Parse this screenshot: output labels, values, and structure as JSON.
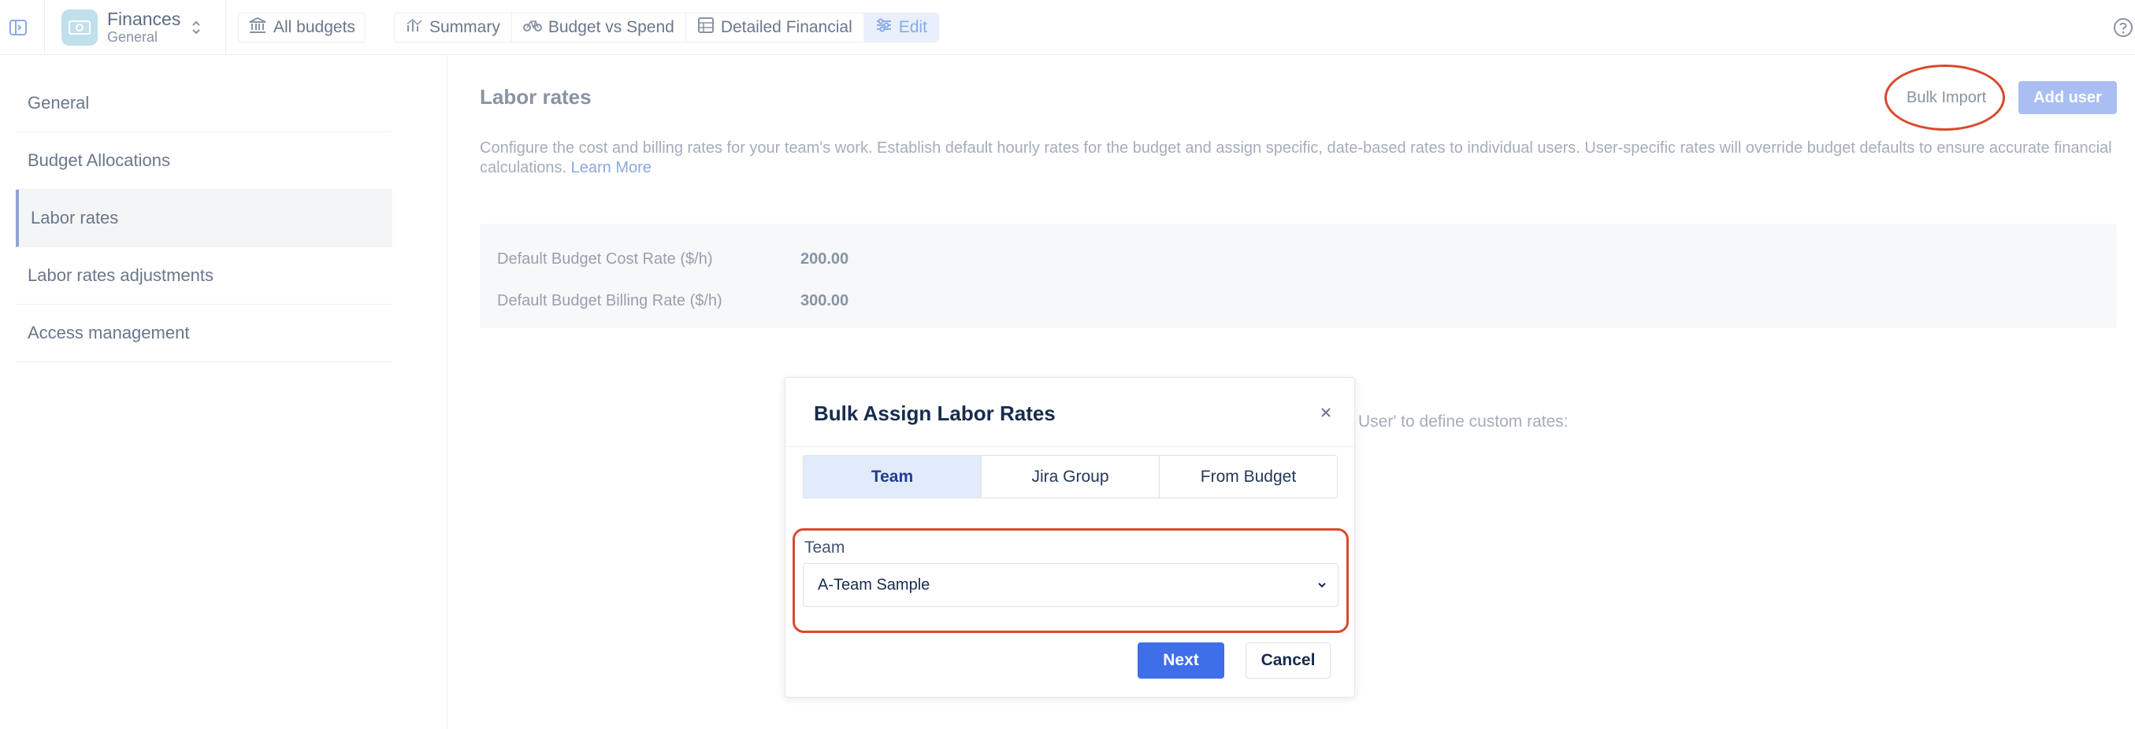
{
  "topbar": {
    "app_title": "Finances",
    "app_subtitle": "General",
    "all_budgets": "All budgets",
    "tabs": [
      {
        "label": "Summary",
        "icon": "chart-icon"
      },
      {
        "label": "Budget vs Spend",
        "icon": "bicycle-icon"
      },
      {
        "label": "Detailed Financial",
        "icon": "table-icon"
      },
      {
        "label": "Edit",
        "icon": "sliders-icon",
        "active": true
      }
    ]
  },
  "sidebar": {
    "items": [
      {
        "label": "General"
      },
      {
        "label": "Budget Allocations"
      },
      {
        "label": "Labor rates",
        "active": true
      },
      {
        "label": "Labor rates adjustments"
      },
      {
        "label": "Access management"
      }
    ]
  },
  "main": {
    "title": "Labor rates",
    "description": "Configure the cost and billing rates for your team's work. Establish default hourly rates for the budget and assign specific, date-based rates to individual users. User-specific rates will override budget defaults to ensure accurate financial calculations.",
    "learn_more": "Learn More",
    "bulk_import": "Bulk Import",
    "add_user": "Add user",
    "default_cost_label": "Default Budget Cost Rate ($/h)",
    "default_cost_value": "200.00",
    "default_billing_label": "Default Budget Billing Rate ($/h)",
    "default_billing_value": "300.00",
    "hint": "User' to define custom rates:"
  },
  "modal": {
    "title": "Bulk Assign Labor Rates",
    "segments": [
      {
        "label": "Team",
        "active": true
      },
      {
        "label": "Jira Group"
      },
      {
        "label": "From Budget"
      }
    ],
    "field_label": "Team",
    "selected_value": "A-Team Sample",
    "next": "Next",
    "cancel": "Cancel"
  },
  "colors": {
    "accent": "#3e6ee8",
    "highlight": "#d9492e"
  }
}
